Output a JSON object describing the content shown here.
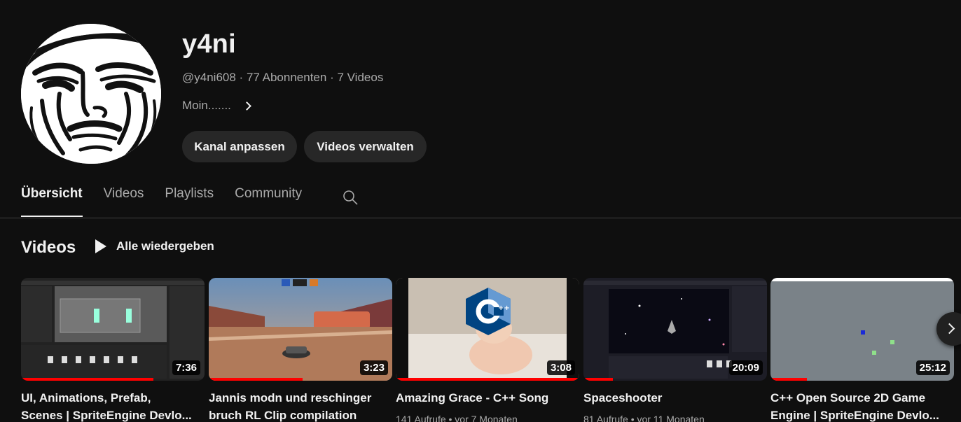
{
  "channel": {
    "name": "y4ni",
    "handle": "@y4ni608",
    "subscribers": "77 Abonnenten",
    "video_count": "7 Videos",
    "description": "Moin.......",
    "buttons": {
      "customize": "Kanal anpassen",
      "manage": "Videos verwalten"
    }
  },
  "tabs": [
    {
      "label": "Übersicht",
      "active": true
    },
    {
      "label": "Videos"
    },
    {
      "label": "Playlists"
    },
    {
      "label": "Community"
    }
  ],
  "section": {
    "title": "Videos",
    "play_all": "Alle wiedergeben"
  },
  "videos": [
    {
      "title_line1": "UI, Animations, Prefab,",
      "title_line2": "Scenes | SpriteEngine Devlo...",
      "duration": "7:36",
      "meta": "",
      "progress": 0.72
    },
    {
      "title_line1": "Jannis modn und reschinger",
      "title_line2": "bruch RL Clip compilation",
      "duration": "3:23",
      "meta": "",
      "progress": 0.51
    },
    {
      "title_line1": "Amazing Grace - C++ Song",
      "title_line2": "",
      "duration": "3:08",
      "meta": "141 Aufrufe • vor 7 Monaten",
      "progress": 1.0
    },
    {
      "title_line1": "Spaceshooter",
      "title_line2": "",
      "duration": "20:09",
      "meta": "81 Aufrufe • vor 11 Monaten",
      "progress": 0.16
    },
    {
      "title_line1": "C++ Open Source 2D Game",
      "title_line2": "Engine | SpriteEngine Devlo...",
      "duration": "25:12",
      "meta": "",
      "progress": 0.2
    }
  ],
  "icons": {
    "search": "search-icon",
    "next": "chevron-right-icon",
    "play": "play-icon"
  },
  "colors": {
    "background": "#0f0f0f",
    "progress": "#ff0000",
    "pill": "#272727"
  }
}
